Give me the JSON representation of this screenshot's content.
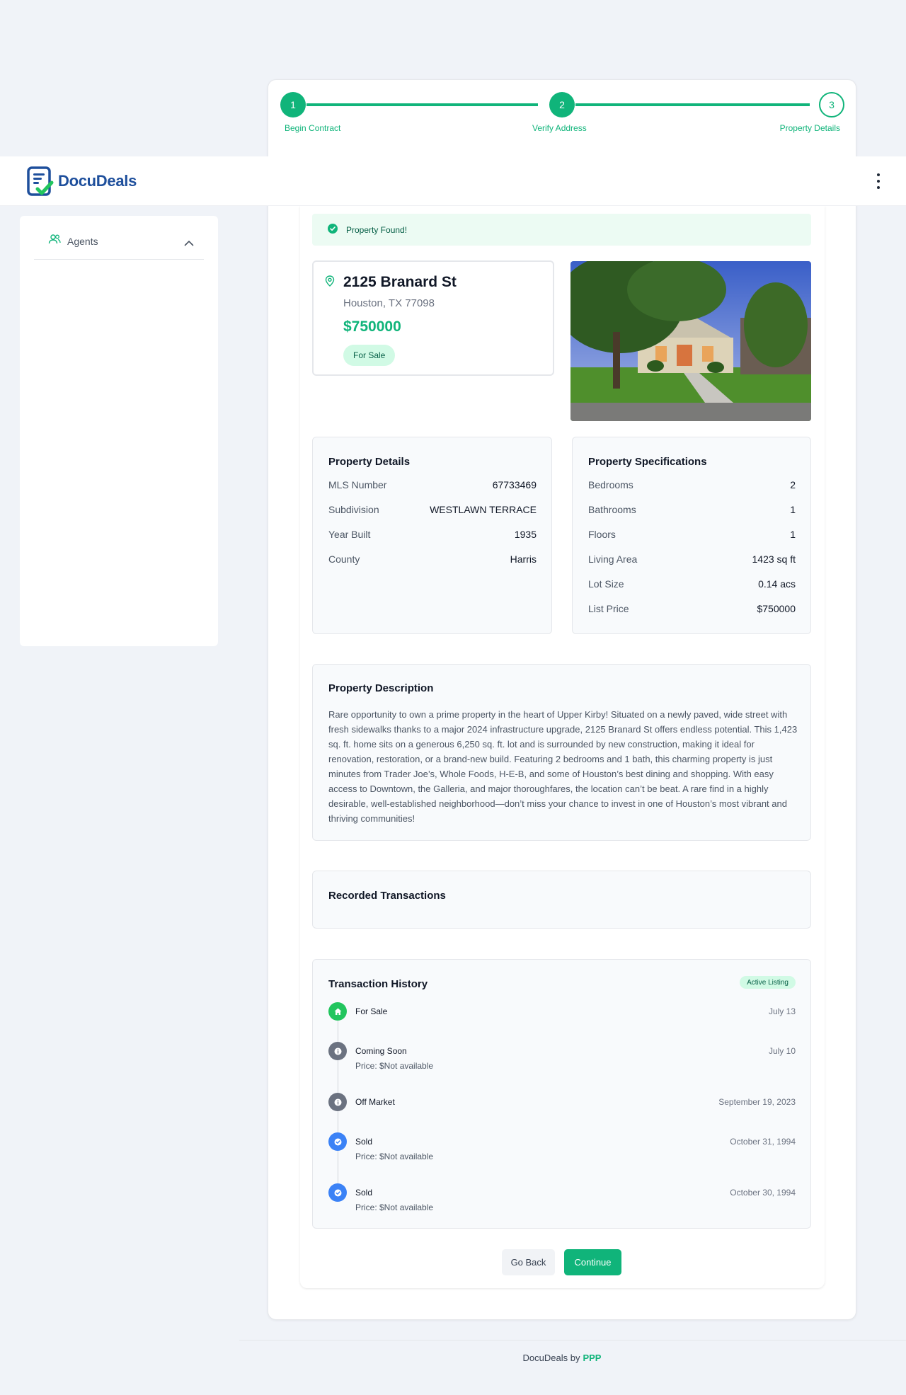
{
  "stepper": {
    "steps": [
      {
        "number": "1",
        "label": "Begin Contract"
      },
      {
        "number": "2",
        "label": "Verify Address"
      },
      {
        "number": "3",
        "label": "Property Details"
      }
    ]
  },
  "header": {
    "app_name": "DocuDeals"
  },
  "sidebar": {
    "items": [
      {
        "label": "Agents"
      }
    ]
  },
  "banner": {
    "text": "Property Found!"
  },
  "property": {
    "street": "2125 Branard St",
    "city": "Houston, TX 77098",
    "price": "$750000",
    "status": "For Sale"
  },
  "details": {
    "title": "Property Details",
    "rows": [
      {
        "label": "MLS Number",
        "value": "67733469"
      },
      {
        "label": "Subdivision",
        "value": "WESTLAWN TERRACE"
      },
      {
        "label": "Year Built",
        "value": "1935"
      },
      {
        "label": "County",
        "value": "Harris"
      }
    ]
  },
  "specs": {
    "title": "Property Specifications",
    "rows": [
      {
        "label": "Bedrooms",
        "value": "2"
      },
      {
        "label": "Bathrooms",
        "value": "1"
      },
      {
        "label": "Floors",
        "value": "1"
      },
      {
        "label": "Living Area",
        "value": "1423 sq ft"
      },
      {
        "label": "Lot Size",
        "value": "0.14 acs"
      },
      {
        "label": "List Price",
        "value": "$750000"
      }
    ]
  },
  "description": {
    "title": "Property Description",
    "text": "Rare opportunity to own a prime property in the heart of Upper Kirby! Situated on a newly paved, wide street with fresh sidewalks thanks to a major 2024 infrastructure upgrade, 2125 Branard St offers endless potential. This 1,423 sq. ft. home sits on a generous 6,250 sq. ft. lot and is surrounded by new construction, making it ideal for renovation, restoration, or a brand-new build. Featuring 2 bedrooms and 1 bath, this charming property is just minutes from Trader Joe’s, Whole Foods, H-E-B, and some of Houston’s best dining and shopping. With easy access to Downtown, the Galleria, and major thoroughfares, the location can’t be beat. A rare find in a highly desirable, well-established neighborhood—don’t miss your chance to invest in one of Houston’s most vibrant and thriving communities!"
  },
  "recorded": {
    "title": "Recorded Transactions"
  },
  "history": {
    "title": "Transaction History",
    "badge": "Active Listing",
    "events": [
      {
        "title": "For Sale",
        "sub": "",
        "date": "July 13",
        "kind": "home",
        "color": "#22c55e"
      },
      {
        "title": "Coming Soon",
        "sub": "Price: $Not available",
        "date": "July 10",
        "kind": "info",
        "color": "#6b7280"
      },
      {
        "title": "Off Market",
        "sub": "",
        "date": "September 19, 2023",
        "kind": "info",
        "color": "#6b7280"
      },
      {
        "title": "Sold",
        "sub": "Price: $Not available",
        "date": "October 31, 1994",
        "kind": "check",
        "color": "#3b82f6"
      },
      {
        "title": "Sold",
        "sub": "Price: $Not available",
        "date": "October 30, 1994",
        "kind": "check",
        "color": "#3b82f6"
      }
    ]
  },
  "actions": {
    "back": "Go Back",
    "continue": "Continue"
  },
  "footer": {
    "prefix": "DocuDeals by",
    "brand": "PPP"
  },
  "colors": {
    "accent": "#10b47a",
    "brand_blue": "#1e4f9c"
  }
}
